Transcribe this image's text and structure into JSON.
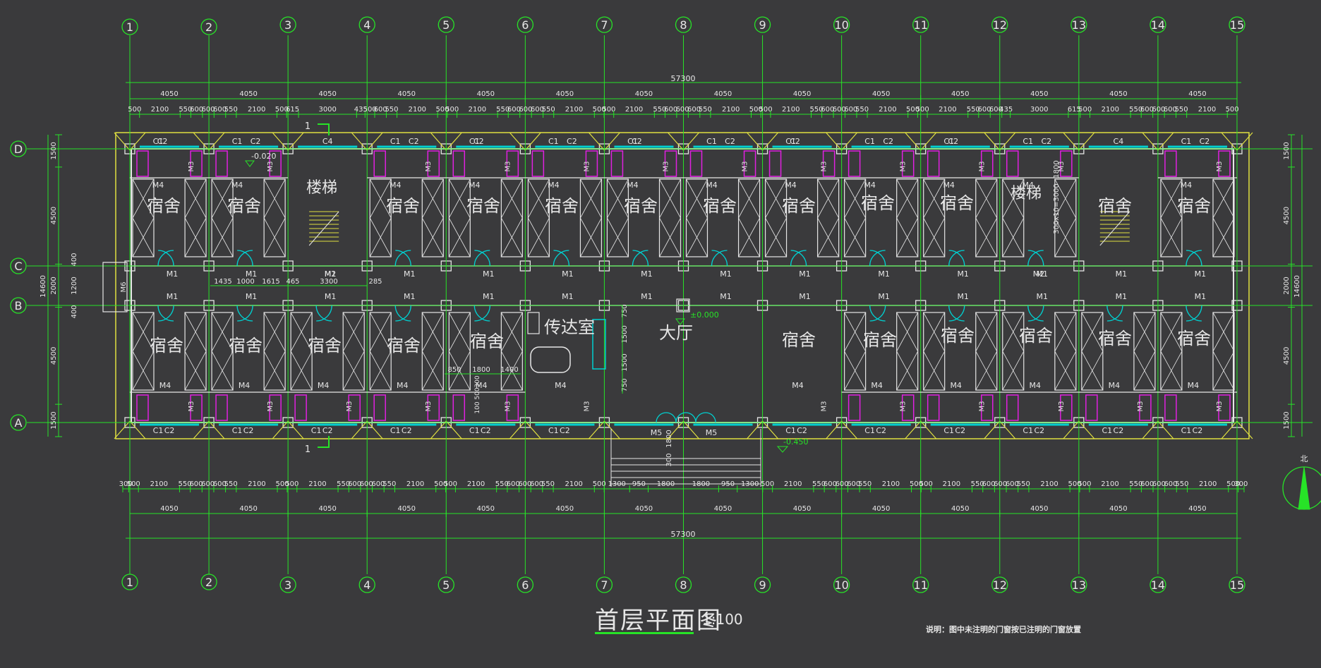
{
  "drawing": {
    "title": "首层平面图",
    "scale": "1:100",
    "note": "说明：图中未注明的门窗按已注明的门窗放置",
    "north_label": "北"
  },
  "axes": {
    "numbers": [
      "1",
      "2",
      "3",
      "4",
      "5",
      "6",
      "7",
      "8",
      "9",
      "10",
      "11",
      "12",
      "13",
      "14",
      "15"
    ],
    "letters": [
      "D",
      "C",
      "B",
      "A"
    ]
  },
  "dimensions": {
    "overall_width": "57300",
    "overall_depth": "14600",
    "bay": "4050",
    "top_window_row": [
      "500",
      "2100",
      "550",
      "600",
      "600",
      "600",
      "550",
      "2100",
      "500",
      "615",
      "3000",
      "435",
      "500",
      "600",
      "550",
      "2100",
      "500",
      "500",
      "2100",
      "550",
      "600",
      "600",
      "600",
      "550",
      "2100",
      "500",
      "500",
      "2100",
      "550",
      "600",
      "600",
      "600",
      "550",
      "2100",
      "500",
      "500",
      "2100",
      "550",
      "600",
      "600",
      "600",
      "550",
      "2100",
      "500",
      "500",
      "2100",
      "550",
      "600",
      "600",
      "435",
      "3000",
      "615",
      "500",
      "2100",
      "550",
      "600",
      "600",
      "600",
      "550",
      "2100",
      "500"
    ],
    "bottom_window_row": [
      "300",
      "500",
      "2100",
      "550",
      "600",
      "600",
      "600",
      "550",
      "2100",
      "500",
      "500",
      "2100",
      "550",
      "600",
      "600",
      "600",
      "550",
      "2100",
      "500",
      "500",
      "2100",
      "550",
      "600",
      "600",
      "600",
      "550",
      "2100",
      "500",
      "1300",
      "950",
      "1800",
      "1800",
      "950",
      "1300",
      "500",
      "2100",
      "550",
      "600",
      "600",
      "600",
      "550",
      "2100",
      "500",
      "500",
      "2100",
      "550",
      "600",
      "600",
      "600",
      "550",
      "2100",
      "500",
      "500",
      "2100",
      "550",
      "600",
      "600",
      "600",
      "550",
      "2100",
      "500",
      "300"
    ],
    "left_row": [
      "1500",
      "4500",
      "2000",
      "4500",
      "1500"
    ],
    "right_row": [
      "1500",
      "4500",
      "2000",
      "4500",
      "1500"
    ],
    "left_inner": [
      "400",
      "1200",
      "400"
    ],
    "corridor_dims": [
      "1435",
      "1000",
      "1615",
      "465",
      "3300",
      "285"
    ],
    "stair_note": "300x10=3000",
    "stair_top": "1800",
    "hall_dims": [
      "750",
      "1500",
      "1500",
      "750"
    ],
    "guard_dims": [
      "850",
      "1800",
      "1400"
    ],
    "guard_small": [
      "100",
      "500",
      "300"
    ],
    "entrance": [
      "1800",
      "300"
    ]
  },
  "rooms": {
    "dorm": "宿舍",
    "stair": "楼梯",
    "guard": "传达室",
    "hall": "大厅"
  },
  "doors": {
    "m1": "M1",
    "m2": "M2",
    "m3": "M3",
    "m4": "M4",
    "m5": "M5",
    "m6": "M6"
  },
  "windows": {
    "c1": "C1",
    "c2": "C2",
    "c4": "C4"
  },
  "levels": {
    "floor": "±0.000",
    "toilet": "-0.020",
    "outside": "-0.450"
  },
  "section_mark": "1",
  "colors": {
    "background": "#3a3a3c",
    "axis": "#27e327",
    "wall": "#e6e6e6",
    "window": "#00d0d0",
    "pier": "#e0e040",
    "toilet": "#e020e0"
  }
}
